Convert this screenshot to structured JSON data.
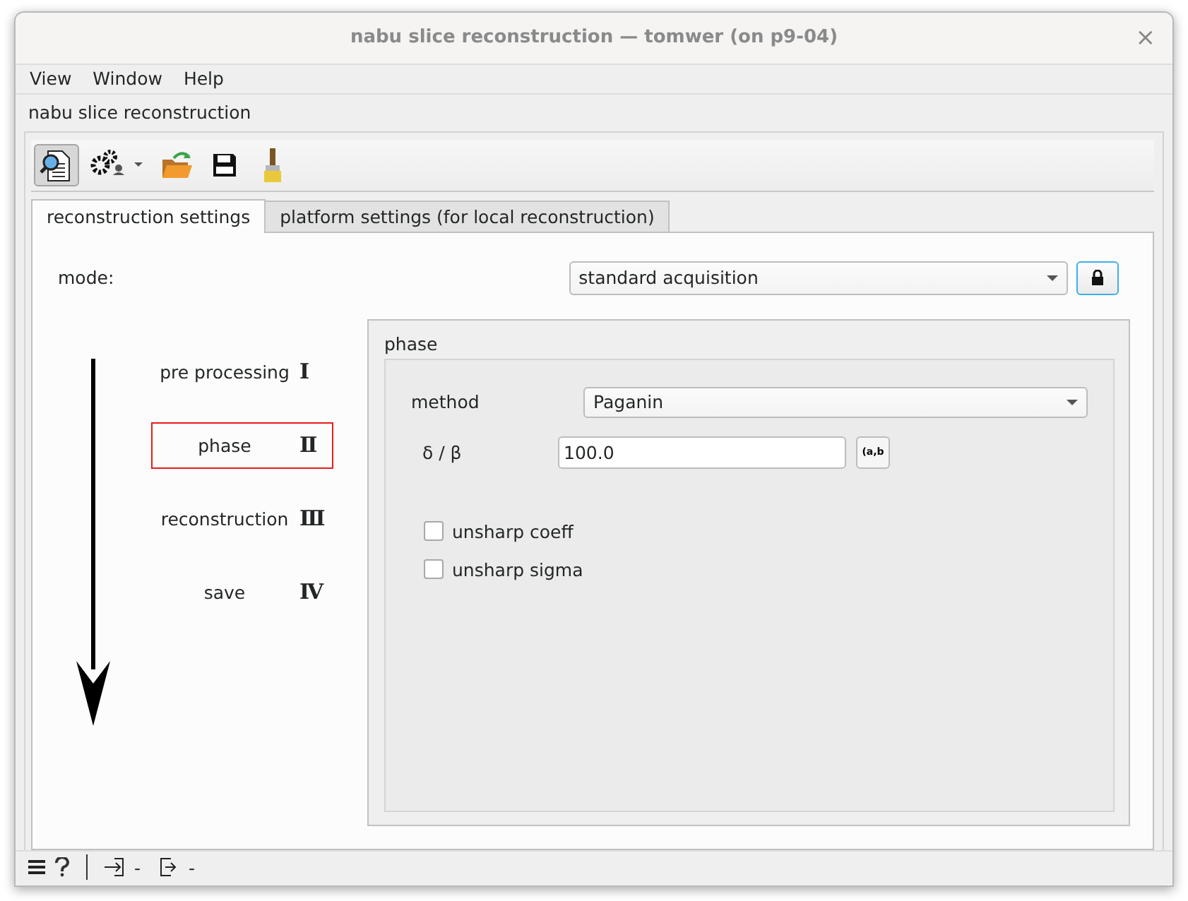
{
  "window": {
    "title": "nabu slice reconstruction — tomwer (on p9-04)",
    "close": "×"
  },
  "menu": [
    "View",
    "Window",
    "Help"
  ],
  "panel_title": "nabu slice reconstruction",
  "toolbar": [
    {
      "kind": "inspect",
      "checked": true
    },
    {
      "kind": "settings",
      "checked": false
    },
    {
      "kind": "open",
      "checked": false
    },
    {
      "kind": "save",
      "checked": false
    },
    {
      "kind": "brush",
      "checked": false
    }
  ],
  "tabs": [
    {
      "label": "reconstruction settings",
      "selected": true
    },
    {
      "label": "platform settings (for local reconstruction)",
      "selected": false
    }
  ],
  "mode": {
    "label": "mode:",
    "value": "standard acquisition"
  },
  "steps": [
    {
      "label": "pre processing",
      "numeral": "Ⅰ",
      "selected": false
    },
    {
      "label": "phase",
      "numeral": "Ⅱ",
      "selected": true
    },
    {
      "label": "reconstruction",
      "numeral": "Ⅲ",
      "selected": false
    },
    {
      "label": "save",
      "numeral": "Ⅳ",
      "selected": false
    }
  ],
  "phase": {
    "title": "phase",
    "method": {
      "label": "method",
      "value": "Paganin"
    },
    "ratio": {
      "label": "δ / β",
      "value": "100.0",
      "button": "(a,b"
    },
    "checkboxes": [
      {
        "label": "unsharp coeff",
        "checked": false
      },
      {
        "label": "unsharp sigma",
        "checked": false
      }
    ]
  },
  "status_bar": [
    {
      "kind": "input",
      "text": "-"
    },
    {
      "kind": "output",
      "text": "-"
    }
  ]
}
